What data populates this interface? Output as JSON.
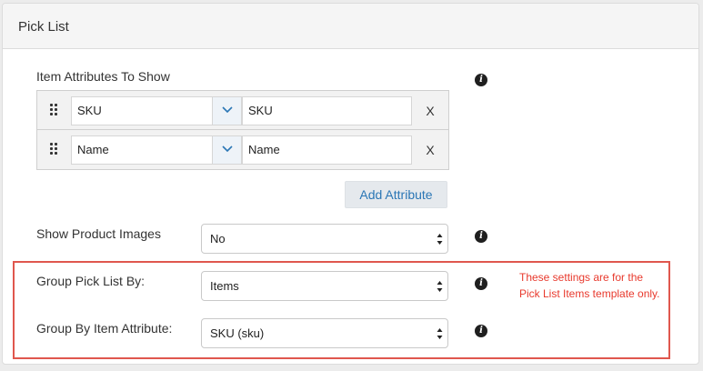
{
  "panel": {
    "title": "Pick List"
  },
  "item_attributes": {
    "label": "Item Attributes To Show",
    "rows": [
      {
        "select_value": "SKU",
        "input_value": "SKU",
        "remove_label": "X"
      },
      {
        "select_value": "Name",
        "input_value": "Name",
        "remove_label": "X"
      }
    ],
    "add_button_label": "Add Attribute"
  },
  "show_product_images": {
    "label": "Show Product Images",
    "value": "No"
  },
  "group_pick_list_by": {
    "label": "Group Pick List By:",
    "value": "Items"
  },
  "group_by_item_attribute": {
    "label": "Group By Item Attribute:",
    "value": "SKU (sku)"
  },
  "info_icon": {
    "glyph": "i",
    "name": "info-icon"
  },
  "note": {
    "line1": "These settings are for the",
    "line2": "Pick List Items template only.",
    "color": "#e8392d"
  },
  "colors": {
    "accent": "#2a76b5",
    "highlight": "#e0574e"
  }
}
